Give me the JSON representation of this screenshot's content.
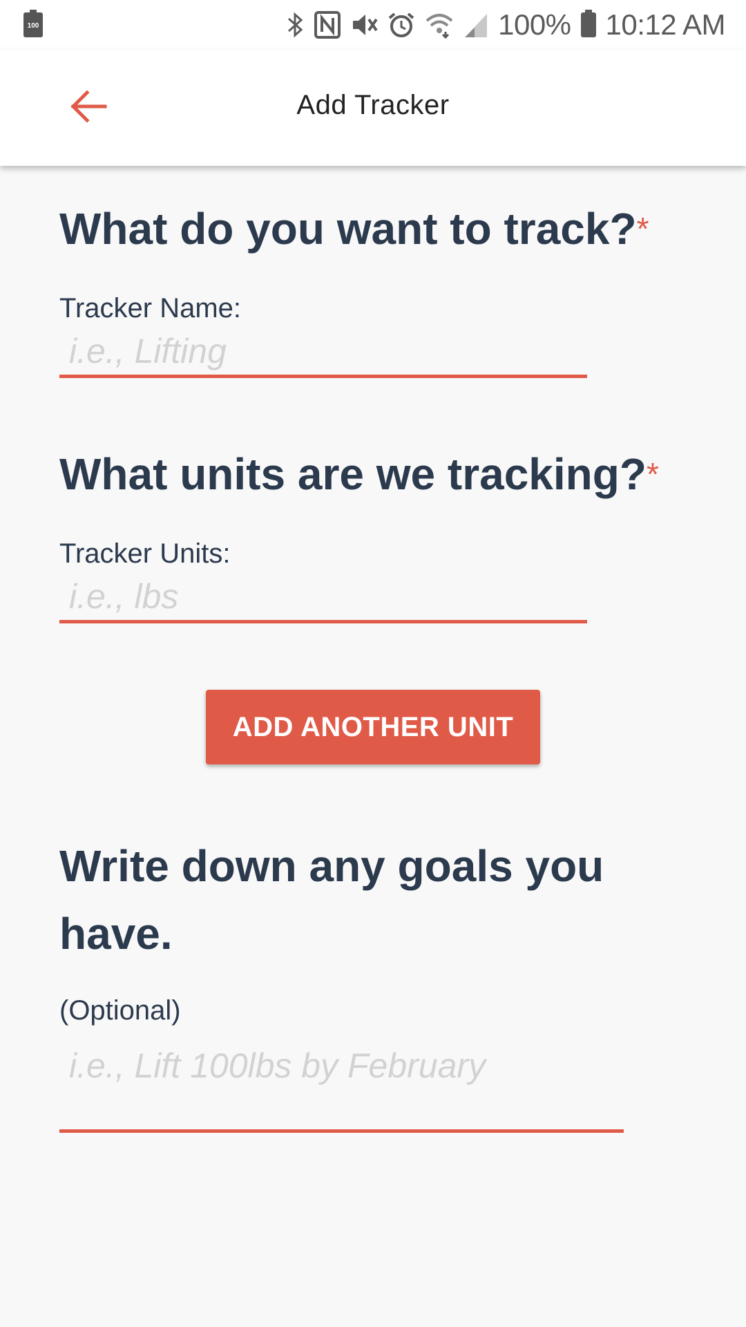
{
  "status_bar": {
    "left_battery_text": "100",
    "battery_percent": "100%",
    "time": "10:12 AM",
    "icons": [
      "bluetooth-icon",
      "nfc-icon",
      "vibrate-icon",
      "alarm-icon",
      "wifi-icon",
      "signal-icon",
      "battery-icon"
    ]
  },
  "app_bar": {
    "title": "Add Tracker",
    "back_icon": "arrow-left-icon",
    "accent_color": "#e05a48"
  },
  "sections": {
    "name": {
      "heading": "What do you want to track?",
      "required_mark": "*",
      "label": "Tracker Name:",
      "placeholder": "i.e., Lifting"
    },
    "units": {
      "heading": "What units are we tracking?",
      "required_mark": "*",
      "label": "Tracker Units:",
      "placeholder": "i.e., lbs",
      "add_button": "ADD ANOTHER UNIT"
    },
    "goals": {
      "heading": "Write down any goals you have.",
      "label": "(Optional)",
      "placeholder": "i.e., Lift 100lbs by February"
    }
  },
  "colors": {
    "heading": "#2c3a4e",
    "accent": "#e05a48",
    "background": "#f8f8f8"
  }
}
